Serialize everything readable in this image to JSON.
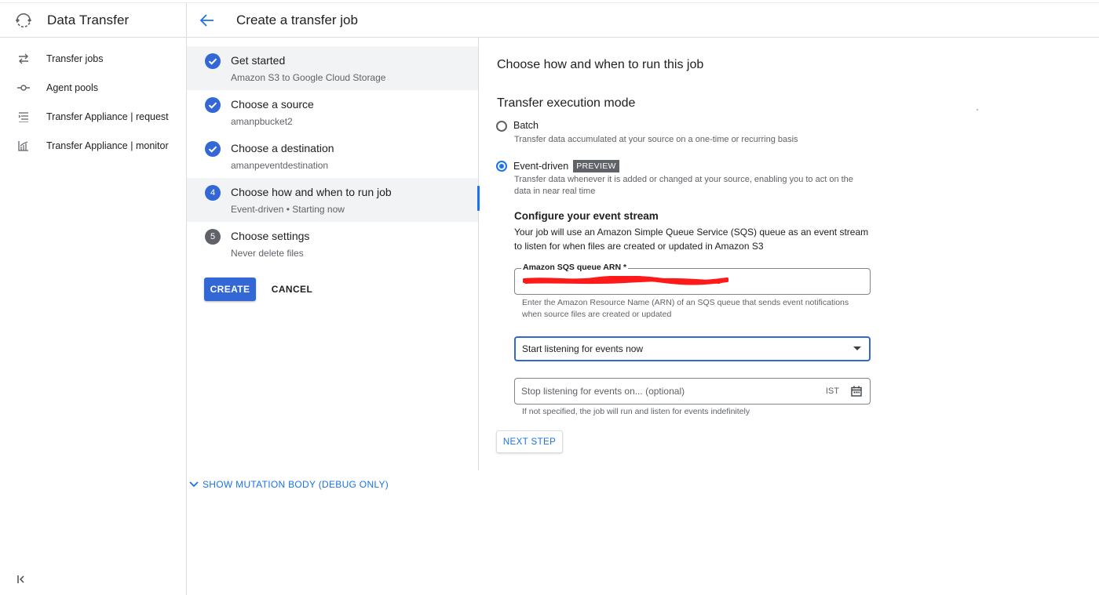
{
  "app": {
    "title": "Data Transfer"
  },
  "nav": {
    "items": [
      {
        "label": "Transfer jobs",
        "icon": "transfer-arrows-icon"
      },
      {
        "label": "Agent pools",
        "icon": "agent-pool-icon"
      },
      {
        "label": "Transfer Appliance | request",
        "icon": "list-request-icon"
      },
      {
        "label": "Transfer Appliance | monitor",
        "icon": "monitor-chart-icon"
      }
    ],
    "collapse_icon": "collapse-sidebar-icon"
  },
  "header": {
    "title": "Create a transfer job",
    "back_icon": "arrow-back-icon"
  },
  "steps": [
    {
      "title": "Get started",
      "subtitle": "Amazon S3 to Google Cloud Storage",
      "state": "done"
    },
    {
      "title": "Choose a source",
      "subtitle": "amanpbucket2",
      "state": "done"
    },
    {
      "title": "Choose a destination",
      "subtitle": "amanpeventdestination",
      "state": "done"
    },
    {
      "number": "4",
      "title": "Choose how and when to run job",
      "subtitle": "Event-driven • Starting now",
      "state": "active"
    },
    {
      "number": "5",
      "title": "Choose settings",
      "subtitle": "Never delete files",
      "state": "pending"
    }
  ],
  "actions": {
    "create": "CREATE",
    "cancel": "CANCEL",
    "debug": "SHOW MUTATION BODY (DEBUG ONLY)"
  },
  "main": {
    "heading": "Choose how and when to run this job",
    "mode_heading": "Transfer execution mode",
    "batch": {
      "label": "Batch",
      "desc": "Transfer data accumulated at your source on a one-time or recurring basis",
      "checked": false
    },
    "event": {
      "label": "Event-driven",
      "badge": "PREVIEW",
      "desc": "Transfer data whenever it is added or changed at your source, enabling you to act on the data in near real time",
      "checked": true
    },
    "stream_heading": "Configure your event stream",
    "stream_desc": "Your job will use an Amazon Simple Queue Service (SQS) queue as an event stream to listen for when files are created or updated in Amazon S3",
    "arn": {
      "label": "Amazon SQS queue ARN *",
      "helper": "Enter the Amazon Resource Name (ARN) of an SQS queue that sends event notifications when source files are created or updated"
    },
    "start_select": {
      "value": "Start listening for events now"
    },
    "stop": {
      "placeholder": "Stop listening for events on... (optional)",
      "tz": "IST",
      "helper": "If not specified, the job will run and listen for events indefinitely"
    },
    "next": "NEXT STEP"
  },
  "colors": {
    "accent": "#1a73e8",
    "primary_button": "#3367d6",
    "redaction": "#ff1a1a"
  }
}
